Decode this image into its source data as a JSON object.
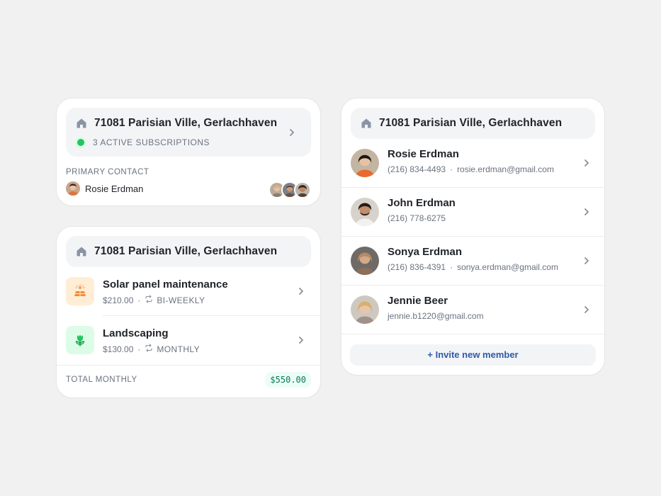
{
  "property_card": {
    "address": "71081 Parisian Ville, Gerlachhaven",
    "subscriptions_status": "3 ACTIVE SUBSCRIPTIONS",
    "primary_contact_label": "PRIMARY CONTACT",
    "primary_contact_name": "Rosie Erdman",
    "status_color": "#22c55e"
  },
  "services_card": {
    "address": "71081 Parisian Ville, Gerlachhaven",
    "services": [
      {
        "title": "Solar panel maintenance",
        "price": "$210.00",
        "frequency": "BI-WEEKLY",
        "icon": "solar-panel-icon",
        "icon_bg": "#ffedd5"
      },
      {
        "title": "Landscaping",
        "price": "$130.00",
        "frequency": "MONTHLY",
        "icon": "plant-icon",
        "icon_bg": "#dcfce7"
      }
    ],
    "total_label": "TOTAL MONTHLY",
    "total_value": "$550.00"
  },
  "members_card": {
    "address": "71081 Parisian Ville, Gerlachhaven",
    "members": [
      {
        "name": "Rosie Erdman",
        "phone": "(216) 834-4493",
        "email": "rosie.erdman@gmail.com"
      },
      {
        "name": "John Erdman",
        "phone": "(216) 778-6275",
        "email": ""
      },
      {
        "name": "Sonya Erdman",
        "phone": "(216) 836-4391",
        "email": "sonya.erdman@gmail.com"
      },
      {
        "name": "Jennie Beer",
        "phone": "",
        "email": "jennie.b1220@gmail.com"
      }
    ],
    "invite_label": "+ Invite new member"
  }
}
